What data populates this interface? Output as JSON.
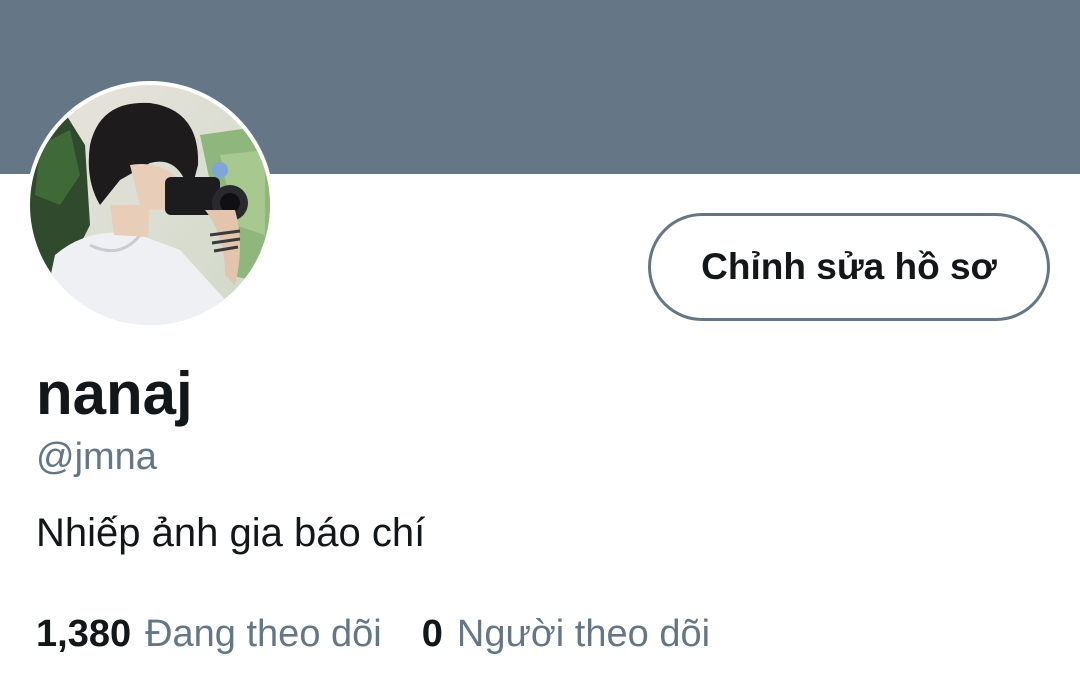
{
  "profile": {
    "display_name": "nanaj",
    "handle": "@jmna",
    "bio": "Nhiếp ảnh gia báo chí",
    "edit_button_label": "Chỉnh sửa hồ sơ",
    "avatar_description": "profile-photo"
  },
  "stats": {
    "following": {
      "count": "1,380",
      "label": "Đang theo dõi"
    },
    "followers": {
      "count": "0",
      "label": "Người theo dõi"
    }
  },
  "colors": {
    "banner": "#657786",
    "primary_text": "#14171a",
    "secondary_text": "#657786",
    "button_border": "#657786",
    "background": "#ffffff"
  }
}
